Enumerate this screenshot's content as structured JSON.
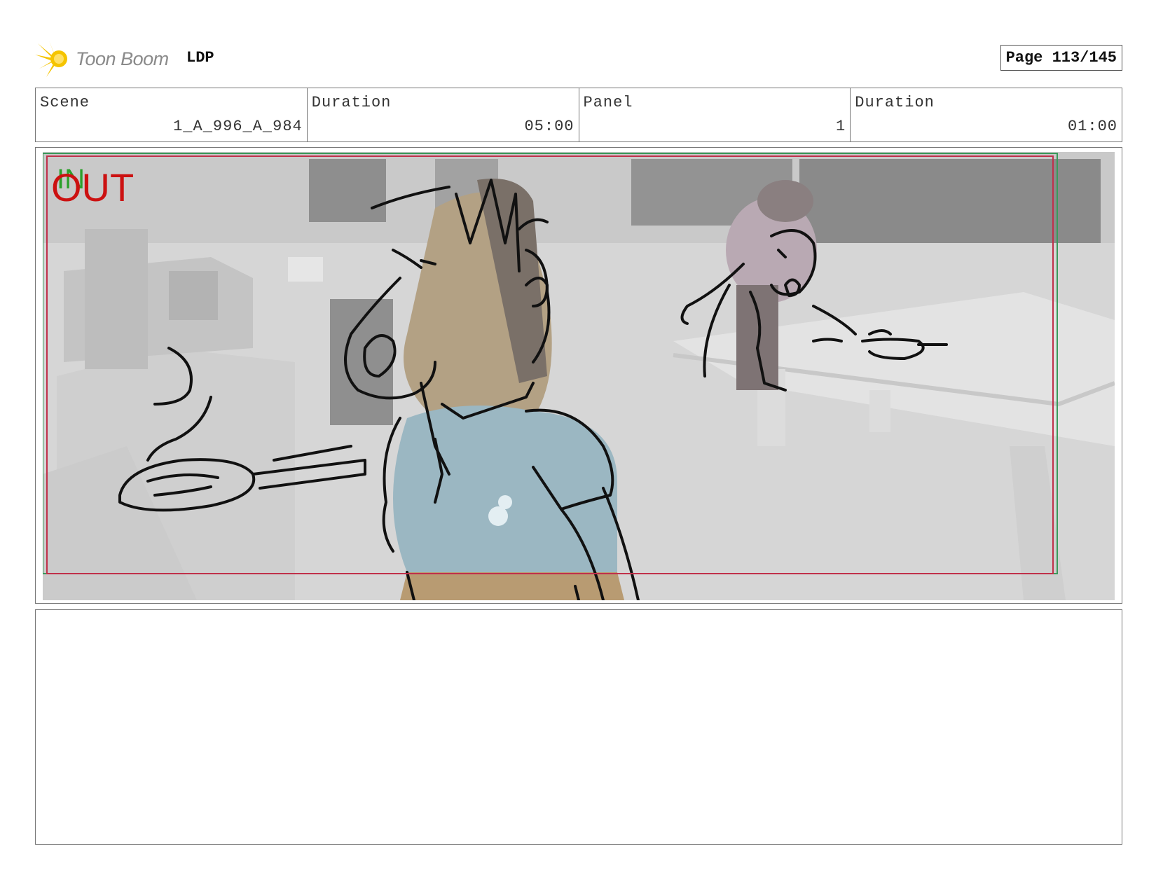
{
  "header": {
    "brand": "Toon Boom",
    "project": "LDP",
    "page_label": "Page 113/145"
  },
  "info": {
    "scene_label": "Scene",
    "scene_value": "1_A_996_A_984",
    "scene_duration_label": "Duration",
    "scene_duration_value": "05:00",
    "panel_label": "Panel",
    "panel_value": "1",
    "panel_duration_label": "Duration",
    "panel_duration_value": "01:00"
  },
  "panel": {
    "in_marker": "IN",
    "out_marker": "OUT"
  },
  "notes": {
    "text": ""
  },
  "colors": {
    "logo_star": "#f5c400",
    "out_marker": "#cc1111",
    "in_marker": "#2aa02a",
    "safe_frame_red": "#c0304a",
    "safe_frame_green": "#3a9a5a",
    "border": "#777777"
  },
  "icons": [
    "toon-boom-star-icon"
  ]
}
